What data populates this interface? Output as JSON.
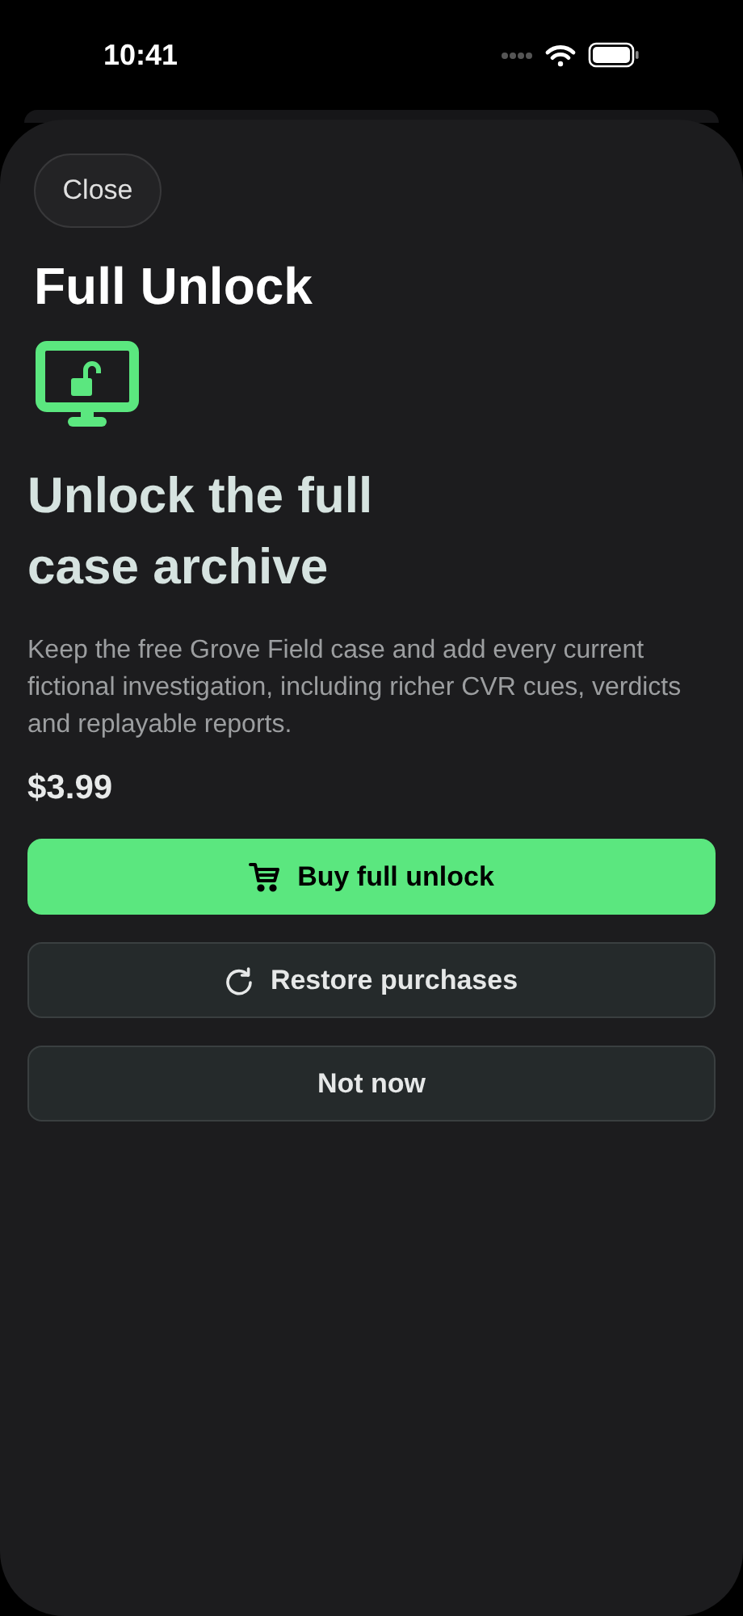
{
  "status_bar": {
    "time": "10:41"
  },
  "sheet": {
    "close_button": "Close",
    "title": "Full Unlock",
    "headline": "Unlock the full case archive",
    "description": "Keep the free Grove Field case and add every current fictional investigation, including richer CVR cues, verdicts and replayable reports.",
    "price": "$3.99",
    "buttons": [
      {
        "label": "Buy full unlock",
        "kind": "buy"
      },
      {
        "label": "Restore purchases",
        "kind": "restore"
      },
      {
        "label": "Not now",
        "kind": "dismiss"
      }
    ]
  }
}
